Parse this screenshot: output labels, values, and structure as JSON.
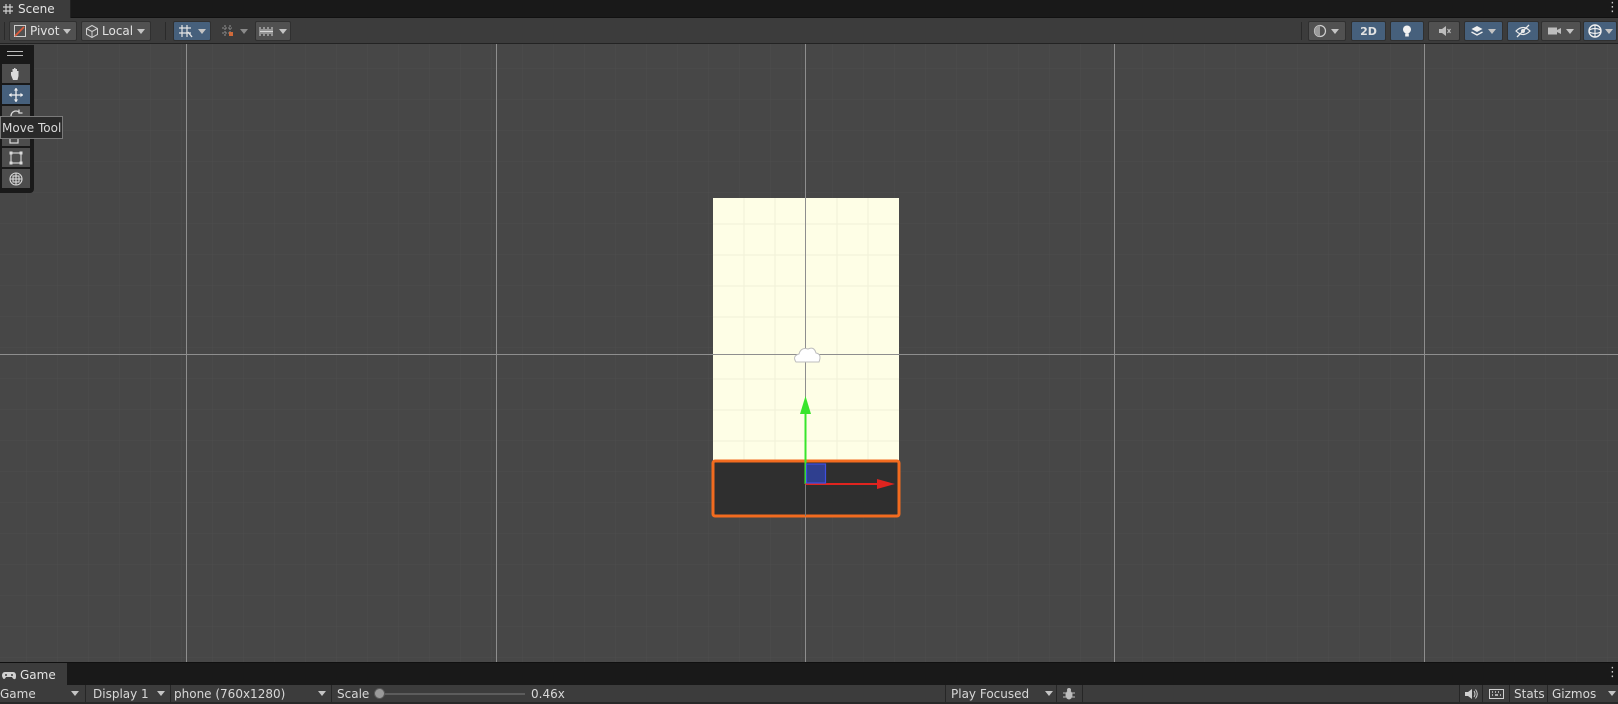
{
  "scene_tab": {
    "label": "Scene",
    "icon": "grid-icon"
  },
  "scene_toolbar": {
    "pivot_label": "Pivot",
    "local_label": "Local",
    "mode_2d_label": "2D"
  },
  "tools": {
    "tooltip": "Move Tool",
    "items": [
      "hand-tool",
      "move-tool",
      "rotate-tool",
      "scale-tool",
      "rect-tool",
      "transform-tool"
    ],
    "active": "move-tool"
  },
  "game_tab": {
    "label": "Game",
    "icon": "gamepad-icon"
  },
  "game_toolbar": {
    "view_select": "Game",
    "display_select": "Display 1",
    "resolution_select": "phone (760x1280)",
    "scale_label": "Scale",
    "scale_value": "0.46x",
    "scale_level": 0.0,
    "play_mode_select": "Play Focused",
    "stats_label": "Stats",
    "gizmos_label": "Gizmos"
  },
  "colors": {
    "viewport_bg": "#474747",
    "canvas_fill": "#fefee6",
    "selection_outline": "#f26b1f",
    "y_axis": "#38e52c",
    "x_axis": "#e0241f",
    "z_handle": "#2f3fcf",
    "active_tool": "#46607c"
  }
}
